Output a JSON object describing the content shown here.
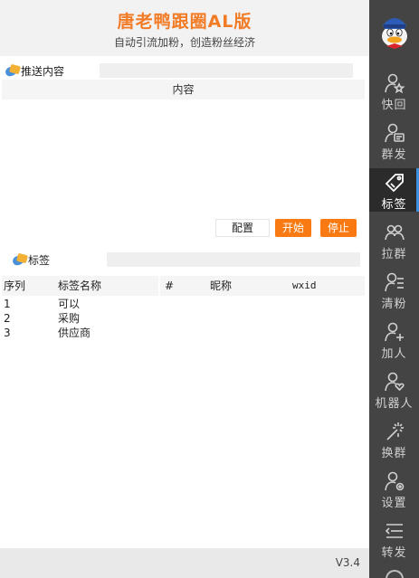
{
  "header": {
    "title": "唐老鸭跟圈AL版",
    "subtitle": "自动引流加粉，创造粉丝经济"
  },
  "push_section": {
    "label": "推送内容",
    "content_column": "内容"
  },
  "buttons": {
    "config": "配置",
    "start": "开始",
    "stop": "停止"
  },
  "tag_section": {
    "label": "标签",
    "columns": [
      "序列",
      "标签名称",
      "#",
      "昵称",
      "wxid"
    ],
    "rows": [
      {
        "index": "1",
        "name": "可以"
      },
      {
        "index": "2",
        "name": "采购"
      },
      {
        "index": "3",
        "name": "供应商"
      }
    ]
  },
  "footer": {
    "version": "V3.4"
  },
  "sidebar": {
    "items": [
      {
        "label": "快回",
        "icon": "person-star-icon"
      },
      {
        "label": "群发",
        "icon": "person-message-icon"
      },
      {
        "label": "标签",
        "icon": "tag-icon",
        "active": true
      },
      {
        "label": "拉群",
        "icon": "group-icon"
      },
      {
        "label": "清粉",
        "icon": "person-list-icon"
      },
      {
        "label": "加人",
        "icon": "person-add-icon"
      },
      {
        "label": "机器人",
        "icon": "person-heart-icon"
      },
      {
        "label": "换群",
        "icon": "magic-wand-icon"
      },
      {
        "label": "设置",
        "icon": "person-gear-icon"
      },
      {
        "label": "转发",
        "icon": "forward-list-icon"
      }
    ]
  },
  "colors": {
    "accent": "#f27b26",
    "button": "#f97a12",
    "sidebar_bg": "#444444",
    "sidebar_active": "#2b2b2b",
    "active_indicator": "#3d8fe0"
  }
}
